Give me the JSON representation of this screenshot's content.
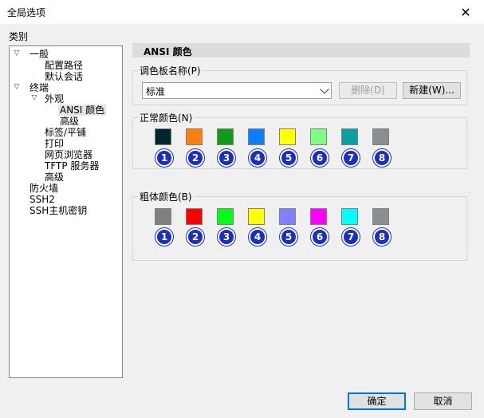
{
  "window": {
    "title": "全局选项",
    "close_glyph": "✕"
  },
  "category_label": "类别",
  "tree": {
    "general": "一般",
    "config_path": "配置路径",
    "default_session": "默认会话",
    "terminal": "终端",
    "appearance": "外观",
    "ansi_colors": "ANSI 颜色",
    "advanced": "高级",
    "tabs_tiling": "标签/平铺",
    "print": "打印",
    "web_browser": "网页浏览器",
    "tftp_server": "TFTP 服务器",
    "advanced2": "高级",
    "firewall": "防火墙",
    "ssh2": "SSH2",
    "ssh_host_keys": "SSH主机密钥"
  },
  "panel": {
    "header": "ANSI 颜色",
    "palette_group": "调色板名称(P)",
    "palette_value": "标准",
    "delete_button": "删除(D)",
    "new_button": "新建(W)...",
    "normal_group": "正常颜色(N)",
    "bold_group": "粗体颜色(B)"
  },
  "numbers": [
    "1",
    "2",
    "3",
    "4",
    "5",
    "6",
    "7",
    "8"
  ],
  "colors": {
    "normal": [
      "#00262f",
      "#ff7f0e",
      "#109c19",
      "#0a7fff",
      "#ffff00",
      "#80ff80",
      "#0aa0a0",
      "#888e94"
    ],
    "bold": [
      "#808080",
      "#ff0000",
      "#00ff18",
      "#ffff00",
      "#8080ff",
      "#ff00ff",
      "#00ffff",
      "#888e94"
    ]
  },
  "footer": {
    "ok": "确定",
    "cancel": "取消"
  }
}
